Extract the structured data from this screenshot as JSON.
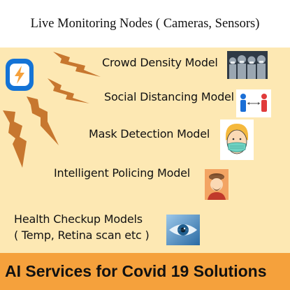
{
  "title": "Live Monitoring Nodes ( Cameras, Sensors)",
  "models": [
    {
      "label": "Crowd Density Model",
      "icon": "crowd-icon"
    },
    {
      "label": "Social Distancing Model",
      "icon": "social-distancing-icon"
    },
    {
      "label": "Mask Detection Model",
      "icon": "mask-face-icon"
    },
    {
      "label": "Intelligent Policing Model",
      "icon": "police-officer-icon"
    },
    {
      "label_line1": "Health Checkup Models",
      "label_line2": "( Temp, Retina scan etc )",
      "icon": "eye-scan-icon"
    }
  ],
  "footer": "AI Services for Covid 19 Solutions",
  "source_icon": "power-app-icon",
  "colors": {
    "panel": "#fde8b3",
    "footer": "#f5a13c",
    "bolt": "#c7772f",
    "app_icon": "#1473d6"
  }
}
